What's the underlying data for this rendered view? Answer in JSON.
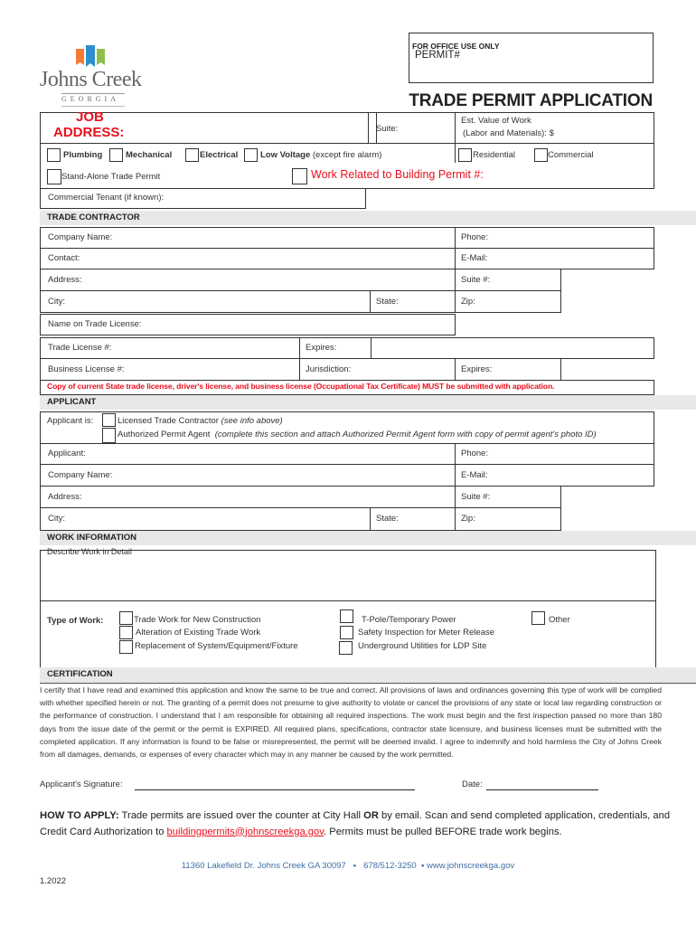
{
  "logo": {
    "name": "Johns Creek",
    "state": "GEORGIA",
    "flag_colors": [
      "#f47b36",
      "#2e8fcc",
      "#8dc04a"
    ]
  },
  "office_box": {
    "label": "FOR OFFICE USE ONLY",
    "permit_label": "PERMIT#"
  },
  "title": "TRADE PERMIT APPLICATION",
  "job": {
    "job_label": "JOB",
    "address_label": "ADDRESS:",
    "suite_label": "Suite:",
    "est_value_line1": "Est. Value of Work",
    "est_value_line2": "(Labor and Materials): $",
    "trades": [
      {
        "label": "Plumbing"
      },
      {
        "label": "Mechanical"
      },
      {
        "label": "Electrical"
      },
      {
        "label": "Low Voltage",
        "note": "(except fire alarm)"
      }
    ],
    "occupancy": [
      {
        "label": "Residential"
      },
      {
        "label": "Commercial"
      }
    ],
    "standalone_label": "Stand-Alone Trade Permit",
    "work_related_label": "Work Related to Building Permit #:",
    "tenant_label": "Commercial Tenant (if known):"
  },
  "trade_contractor": {
    "header": "TRADE CONTRACTOR",
    "company": "Company Name:",
    "phone": "Phone:",
    "contact": "Contact:",
    "email": "E-Mail:",
    "address": "Address:",
    "suite": "Suite #:",
    "city": "City:",
    "state": "State:",
    "zip": "Zip:",
    "name_on_license": "Name on Trade License:",
    "trade_license": "Trade License #:",
    "expires1": "Expires:",
    "business_license": "Business License #:",
    "jurisdiction": "Jurisdiction:",
    "expires2": "Expires:",
    "notice": "Copy of current State trade license, driver's license, and business license (Occupational Tax Certificate) MUST be submitted with application."
  },
  "applicant": {
    "header": "APPLICANT",
    "applicant_is": "Applicant is:",
    "option1": "Licensed Trade Contractor",
    "option1_note": "(see info above)",
    "option2": "Authorized Permit Agent",
    "option2_note": "(complete this section and attach Authorized Permit Agent form with copy of permit agent's photo ID)",
    "applicant": "Applicant:",
    "phone": "Phone:",
    "company": "Company Name:",
    "email": "E-Mail:",
    "address": "Address:",
    "suite": "Suite #:",
    "city": "City:",
    "state": "State:",
    "zip": "Zip:"
  },
  "work_info": {
    "header": "WORK INFORMATION",
    "describe_label": "Describe Work in Detail",
    "type_label": "Type of Work:",
    "types_col1": [
      "Trade Work for New Construction",
      "Alteration of Existing Trade Work",
      "Replacement of System/Equipment/Fixture"
    ],
    "types_col2": [
      "T-Pole/Temporary Power",
      "Safety Inspection for Meter Release",
      "Underground Utilities for LDP Site"
    ],
    "types_col3": [
      "Other"
    ]
  },
  "certification": {
    "header": "CERTIFICATION",
    "text": "I certify that I have read and examined this application and know the same to be true and correct. All provisions of laws and ordinances governing this type of work will be complied with whether specified herein or not. The granting of a permit does not presume to give authority to violate or cancel the provisions of any state or local law regarding construction or the performance of construction. I understand that I am responsible for obtaining all required inspections. The work must begin and the first inspection passed no more than 180 days from the issue date of the permit or the permit is EXPIRED. All required plans, specifications, contractor state licensure, and business licenses must be submitted with the completed application. If any information is found to be false or misrepresented, the permit will be deemed invalid. I agree to indemnify and hold harmless the City of Johns Creek from all damages, demands, or expenses of every character which may in any manner be caused by the work permitted.",
    "signature_label": "Applicant's Signature:",
    "date_label": "Date:"
  },
  "how_to_apply": {
    "bold_lead": "HOW TO APPLY:",
    "text1": " Trade permits are issued over the counter at City Hall ",
    "or": "OR",
    "text2": " by email. Scan and send completed application, credentials, and Credit Card Authorization to ",
    "email": "buildingpermits@johnscreekga.gov",
    "text3": ". Permits must be pulled BEFORE trade work begins."
  },
  "footer": {
    "address": "11360 Lakefield Dr. Johns Creek GA 30097",
    "phone": "678/512-3250",
    "website": "www.johnscreekga.gov",
    "version": "1.2022"
  }
}
